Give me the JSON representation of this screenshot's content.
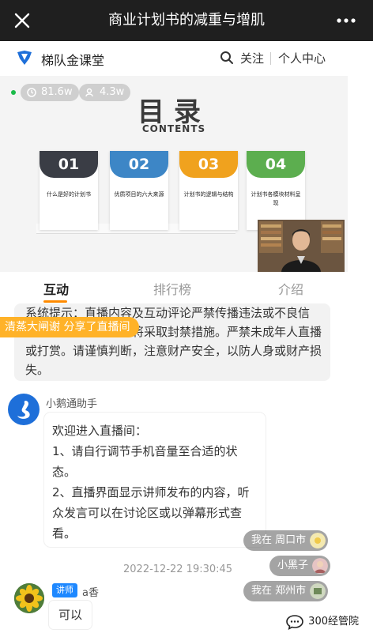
{
  "topbar": {
    "title": "商业计划书的减重与增肌"
  },
  "header": {
    "brand": "梯队金课堂",
    "follow": "关注",
    "center": "个人中心"
  },
  "stats": {
    "views": "81.6w",
    "users": "4.3w"
  },
  "slide": {
    "title": "目录",
    "subtitle": "CONTENTS",
    "cards": [
      {
        "num": "01",
        "text": "什么是好的计划书",
        "color": "#3a3d45"
      },
      {
        "num": "02",
        "text": "优质项目的六大来源",
        "color": "#3d86c6"
      },
      {
        "num": "03",
        "text": "计划书的逻辑与结构",
        "color": "#f0a21e"
      },
      {
        "num": "04",
        "text": "计划书各模块材料呈现",
        "color": "#5cae4f"
      }
    ]
  },
  "tabs": [
    "互动",
    "排行榜",
    "介绍"
  ],
  "system": {
    "text": "系统提示：直播内容及互动评论严禁传播违法或不良信息，如有违反，我们将采取封禁措施。严禁未成年人直播或打赏。请谨慎判断，注意财产安全，以防人身或财产损失。"
  },
  "share": {
    "text": "清蒸大闸谢 分享了直播间"
  },
  "bot": {
    "name": "小鹅通助手",
    "lines": [
      "欢迎进入直播间：",
      "1、请自行调节手机音量至合适的状态。",
      "2、直播界面显示讲师发布的内容，听众发言可以在讨论区或以弹幕形式查看。"
    ]
  },
  "time": "2022-12-22 19:30:45",
  "danmu": [
    "我在 周口市",
    "小黑子",
    "我在 郑州市"
  ],
  "lecturer": {
    "tag": "讲师",
    "name": "a香",
    "reply": "可以"
  },
  "watermark": {
    "text": "300经管院"
  },
  "colors": {
    "accent": "#ff8a00",
    "share": "#ffb228",
    "tag": "#1e88ff"
  }
}
